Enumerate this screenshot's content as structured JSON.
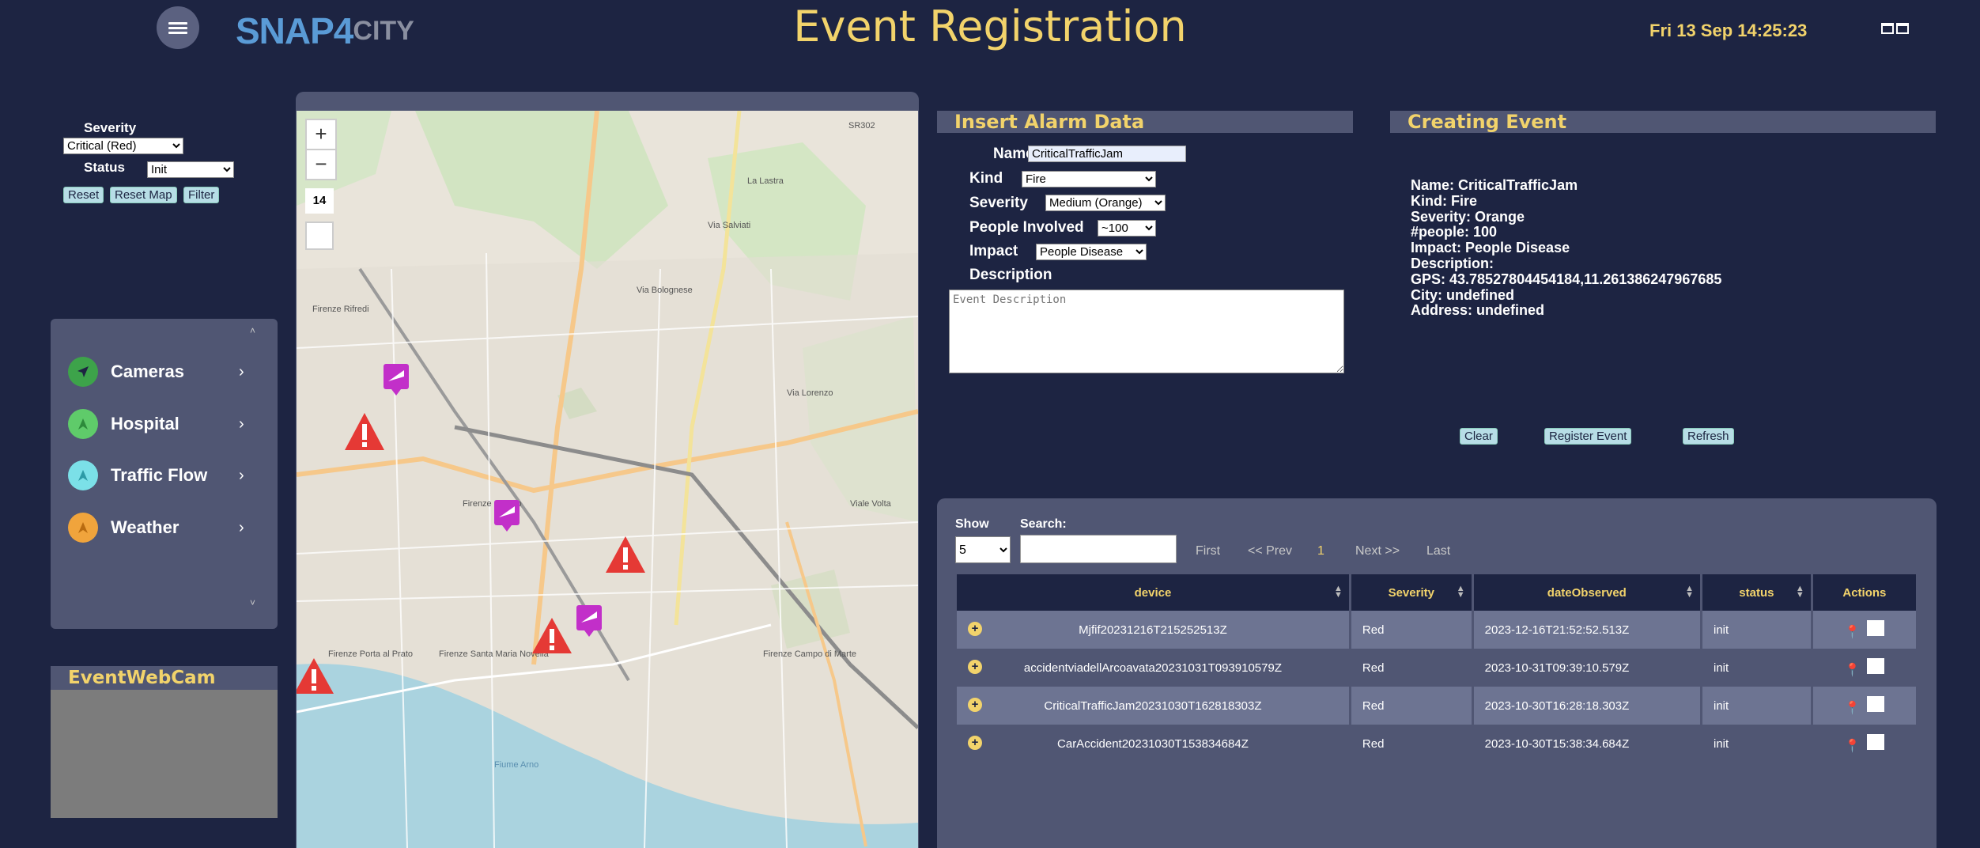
{
  "header": {
    "logo_main": "SNAP4",
    "logo_suffix": "CITY",
    "title": "Event Registration",
    "clock": "Fri 13 Sep 14:25:23"
  },
  "filters": {
    "severity_label": "Severity",
    "severity_value": "Critical (Red)",
    "status_label": "Status",
    "status_value": "Init",
    "reset_label": "Reset",
    "reset_map_label": "Reset Map",
    "filter_label": "Filter"
  },
  "categories": [
    {
      "label": "Cameras",
      "color": "#3da34a"
    },
    {
      "label": "Hospital",
      "color": "#5fcb6a"
    },
    {
      "label": "Traffic Flow",
      "color": "#7be0e8"
    },
    {
      "label": "Weather",
      "color": "#f0a43c"
    }
  ],
  "webcam": {
    "title": "EventWebCam"
  },
  "map": {
    "zoom_level": "14",
    "zoom_in": "+",
    "zoom_out": "−",
    "labels": [
      "SR302",
      "La Lastra",
      "Via Salviati",
      "Via Bolognese",
      "Firenze Rifredi",
      "Firenze Statuto",
      "Firenze Porta al Prato",
      "Firenze Santa Maria Novella",
      "Firenze Campo di Marte",
      "Fiume Arno",
      "Viale Volta",
      "Via Lorenzo"
    ]
  },
  "insert_alarm": {
    "title": "Insert Alarm Data",
    "name_label": "Name",
    "name_value": "CriticalTrafficJam",
    "kind_label": "Kind",
    "kind_value": "Fire",
    "severity_label": "Severity",
    "severity_value": "Medium (Orange)",
    "people_label": "People Involved",
    "people_value": "~100",
    "impact_label": "Impact",
    "impact_value": "People Disease",
    "description_label": "Description",
    "description_placeholder": "Event Description"
  },
  "creating_event": {
    "title": "Creating Event",
    "lines": [
      "Name: CriticalTrafficJam",
      "Kind: Fire",
      "Severity: Orange",
      "#people: 100",
      "Impact: People Disease",
      "Description:",
      "GPS: 43.78527804454184,11.261386247967685",
      "City: undefined",
      "Address: undefined"
    ],
    "clear_label": "Clear",
    "register_label": "Register Event",
    "refresh_label": "Refresh"
  },
  "table": {
    "show_label": "Show",
    "show_value": "5",
    "search_label": "Search:",
    "pager": {
      "first": "First",
      "prev": "<< Prev",
      "page": "1",
      "next": "Next >>",
      "last": "Last"
    },
    "columns": [
      "device",
      "Severity",
      "dateObserved",
      "status",
      "Actions"
    ],
    "rows": [
      {
        "device": "Mjfif20231216T215252513Z",
        "severity": "Red",
        "date": "2023-12-16T21:52:52.513Z",
        "status": "init"
      },
      {
        "device": "accidentviadellArcoavata20231031T093910579Z",
        "severity": "Red",
        "date": "2023-10-31T09:39:10.579Z",
        "status": "init"
      },
      {
        "device": "CriticalTrafficJam20231030T162818303Z",
        "severity": "Red",
        "date": "2023-10-30T16:28:18.303Z",
        "status": "init"
      },
      {
        "device": "CarAccident20231030T153834684Z",
        "severity": "Red",
        "date": "2023-10-30T15:38:34.684Z",
        "status": "init"
      }
    ]
  },
  "colors": {
    "background": "#1d2442",
    "panel": "#505673",
    "accent": "#f2d36b"
  }
}
